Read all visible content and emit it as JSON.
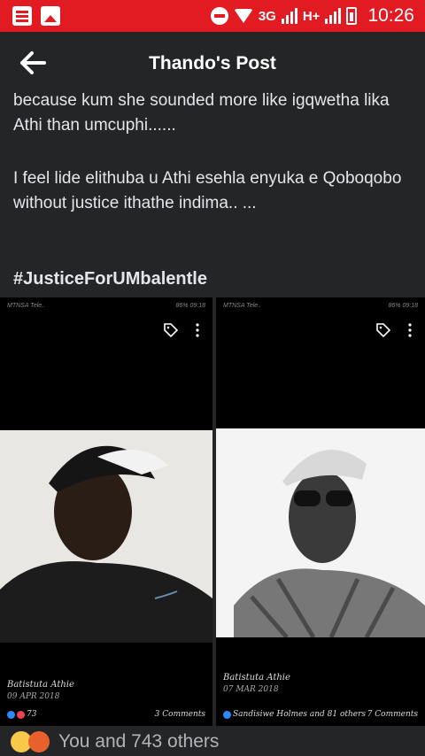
{
  "status_bar": {
    "network": "3G",
    "network2": "H+",
    "time": "10:26"
  },
  "header": {
    "title": "Thando's Post"
  },
  "post": {
    "paragraph1": "because kum she sounded more like igqwetha lika Athi than umcuphi......",
    "paragraph2": "I feel lide elithuba u Athi esehla enyuka e Qoboqobo without justice ithathe indima.. ...",
    "hashtag": "#JusticeForUMbalentle"
  },
  "photos": [
    {
      "mini_status_left": "MTNSA Tele..",
      "mini_status_right": "86% 09:18",
      "name": "Batistuta Athie",
      "date": "09 APR 2018",
      "reactions": "73",
      "comments": "3 Comments"
    },
    {
      "mini_status_left": "MTNSA Tele..",
      "mini_status_right": "86% 09:18",
      "name": "Batistuta Athie",
      "date": "07 MAR 2018",
      "reactions": "Sandisiwe Holmes and 81 others",
      "comments": "7 Comments"
    }
  ],
  "reactions_bar": {
    "text": "You and 743 others"
  },
  "colors": {
    "status_bar": "#e21b23",
    "background": "#242526",
    "text": "#e4e6eb"
  }
}
